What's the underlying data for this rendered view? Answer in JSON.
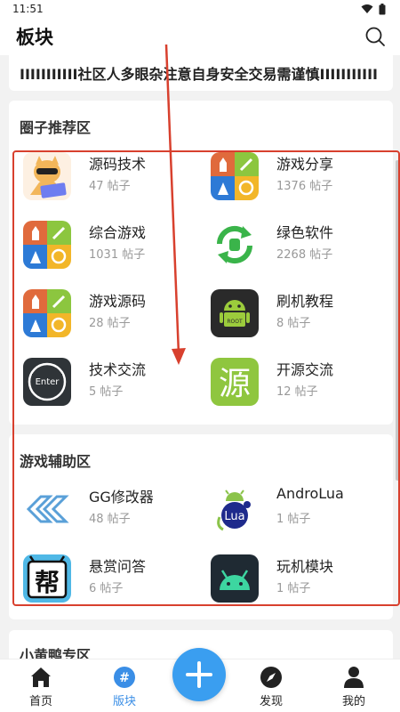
{
  "status": {
    "time": "11:51"
  },
  "header": {
    "title": "板块"
  },
  "notice": {
    "text": "IIIIIIIIIII社区人多眼杂注意自身安全交易需谨慎IIIIIIIIIII"
  },
  "sections": [
    {
      "title": "圈子推荐区",
      "items": [
        {
          "name": "源码技术",
          "count": "47 帖子",
          "icon": "cartoon-animal-laptop-icon"
        },
        {
          "name": "游戏分享",
          "count": "1376 帖子",
          "icon": "game-tiles-icon"
        },
        {
          "name": "综合游戏",
          "count": "1031 帖子",
          "icon": "game-tiles-icon"
        },
        {
          "name": "绿色软件",
          "count": "2268 帖子",
          "icon": "green-refresh-icon"
        },
        {
          "name": "游戏源码",
          "count": "28 帖子",
          "icon": "game-tiles-icon"
        },
        {
          "name": "刷机教程",
          "count": "8 帖子",
          "icon": "android-root-icon"
        },
        {
          "name": "技术交流",
          "count": "5 帖子",
          "icon": "enter-circle-icon"
        },
        {
          "name": "开源交流",
          "count": "12 帖子",
          "icon": "yuan-character-icon"
        }
      ]
    },
    {
      "title": "游戏辅助区",
      "items": [
        {
          "name": "GG修改器",
          "count": "48 帖子",
          "icon": "gg-logo-icon"
        },
        {
          "name": "AndroLua",
          "count": "1 帖子",
          "icon": "lua-android-icon"
        },
        {
          "name": "悬赏问答",
          "count": "6 帖子",
          "icon": "bang-character-icon"
        },
        {
          "name": "玩机模块",
          "count": "1 帖子",
          "icon": "android-dark-icon"
        }
      ]
    },
    {
      "title": "小黄鸭专区",
      "items": []
    }
  ],
  "bottom_nav": [
    {
      "label": "首页",
      "icon": "home-icon"
    },
    {
      "label": "版块",
      "icon": "hash-icon"
    },
    {
      "label": "",
      "icon": "plus-icon"
    },
    {
      "label": "发现",
      "icon": "compass-icon"
    },
    {
      "label": "我的",
      "icon": "person-icon"
    }
  ],
  "colors": {
    "accent": "#3a9ef0",
    "highlight": "#d8402e"
  }
}
